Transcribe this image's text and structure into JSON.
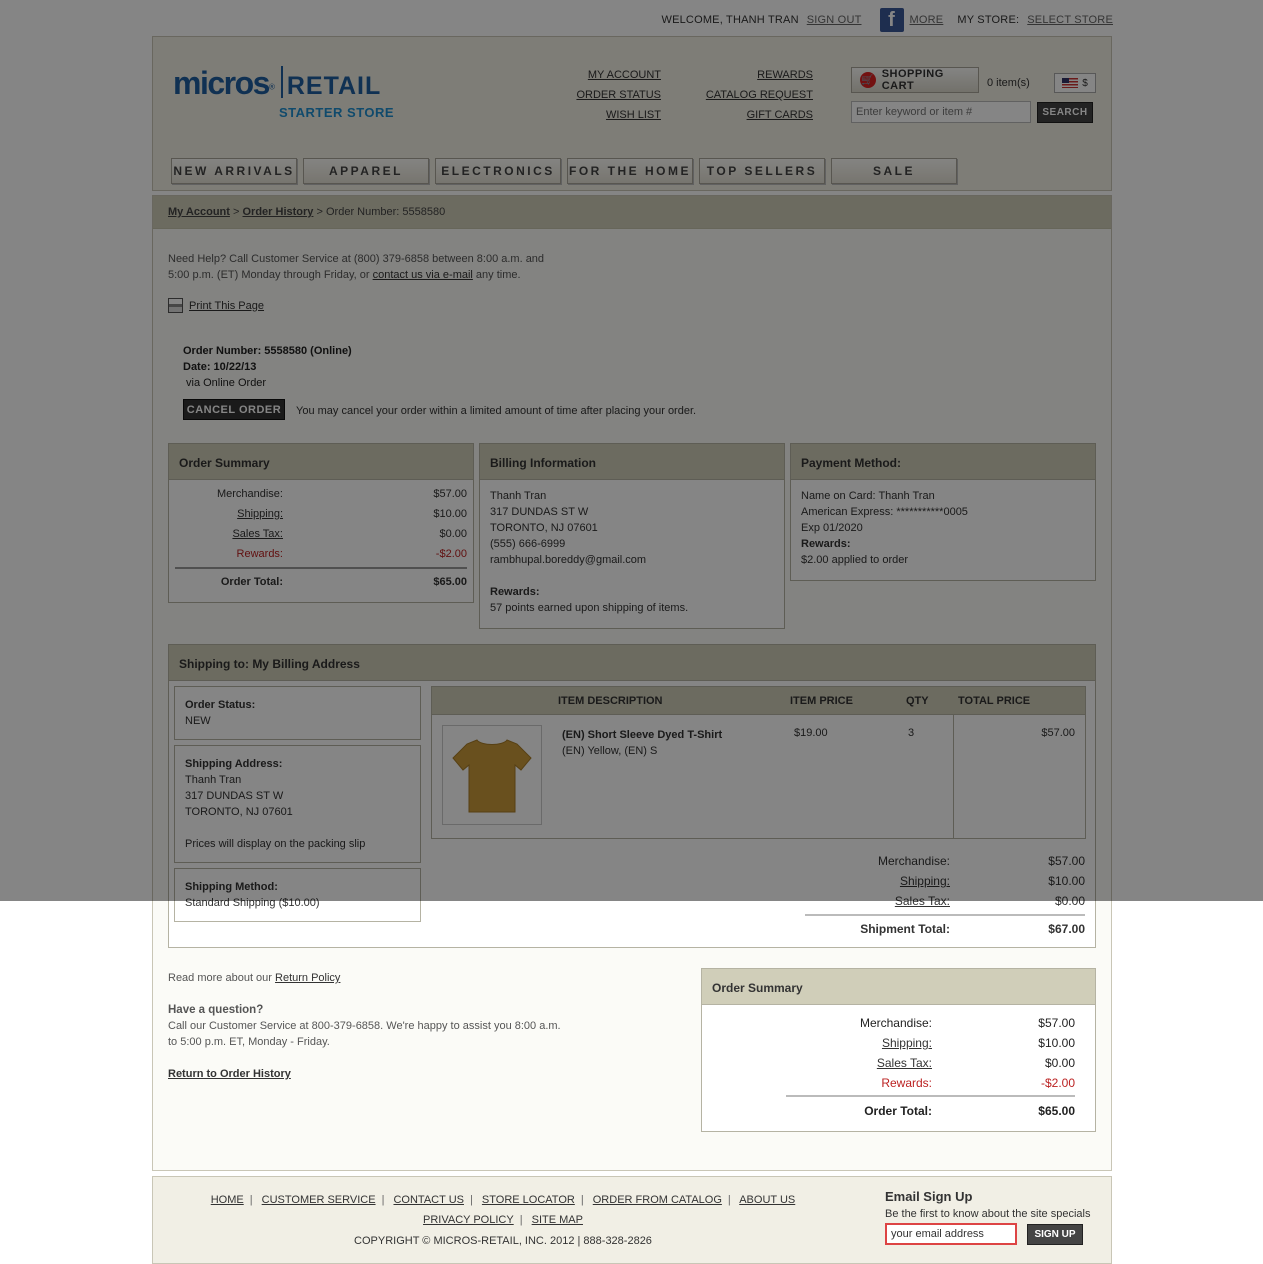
{
  "topbar": {
    "welcome": "WELCOME, THANH TRAN",
    "sign_out": "SIGN OUT",
    "more": "MORE",
    "my_store": "MY STORE:",
    "select_store": "SELECT STORE"
  },
  "logo": {
    "micros": "micros",
    "retail": "RETAIL",
    "starter": "STARTER STORE",
    "reg": "®"
  },
  "header_links_col1": [
    "MY ACCOUNT",
    "ORDER STATUS",
    "WISH LIST"
  ],
  "header_links_col2": [
    "REWARDS",
    "CATALOG REQUEST",
    "GIFT CARDS"
  ],
  "cart": {
    "label": "SHOPPING CART",
    "count": "0 item(s)",
    "currency": "$"
  },
  "search": {
    "placeholder": "Enter keyword or item #",
    "button": "SEARCH"
  },
  "nav": [
    "NEW ARRIVALS",
    "APPAREL",
    "ELECTRONICS",
    "FOR THE HOME",
    "TOP SELLERS",
    "SALE"
  ],
  "breadcrumb": {
    "my_account": "My Account",
    "order_history": "Order History",
    "sep": ">",
    "current": "Order Number: 5558580"
  },
  "help": {
    "line1": "Need Help?  Call Customer Service at (800) 379-6858 between 8:00 a.m. and",
    "line2_pre": "5:00 p.m. (ET) Monday through Friday, or ",
    "contact_link": "contact us via e-mail",
    "line2_post": " any time."
  },
  "print": "Print This Page",
  "order": {
    "number": "Order Number: 5558580 (Online)",
    "date": "Date: 10/22/13",
    "via": "via Online Order",
    "cancel_button": "CANCEL ORDER",
    "cancel_msg": "You may cancel your order within a limited amount of time after placing your order."
  },
  "order_summary": {
    "title": "Order Summary",
    "merchandise_label": "Merchandise:",
    "merchandise": "$57.00",
    "shipping_label": "Shipping:",
    "shipping": "$10.00",
    "tax_label": "Sales Tax:",
    "tax": "$0.00",
    "rewards_label": "Rewards:",
    "rewards": "-$2.00",
    "total_label": "Order Total:",
    "total": "$65.00"
  },
  "billing": {
    "title": "Billing Information",
    "name": "Thanh Tran",
    "street": "317 DUNDAS ST W",
    "city": "TORONTO, NJ 07601",
    "phone": "(555) 666-6999",
    "email": "rambhupal.boreddy@gmail.com",
    "rewards_label": "Rewards:",
    "rewards": "57 points earned upon shipping of items."
  },
  "payment": {
    "title": "Payment Method:",
    "name": "Name on Card: Thanh Tran",
    "card": "American Express: ***********0005",
    "exp": "Exp 01/2020",
    "rewards_label": "Rewards:",
    "rewards": "$2.00 applied to order"
  },
  "shipping": {
    "title": "Shipping to:  My Billing Address",
    "status_label": "Order Status:",
    "status": "NEW",
    "address_label": "Shipping Address:",
    "name": "Thanh Tran",
    "street": "317 DUNDAS ST W",
    "city": "TORONTO, NJ 07601",
    "note": "Prices will display on the packing slip",
    "method_label": "Shipping Method:",
    "method": "Standard Shipping ($10.00)"
  },
  "items_table": {
    "headers": [
      "ITEM DESCRIPTION",
      "ITEM PRICE",
      "QTY",
      "TOTAL PRICE"
    ],
    "rows": [
      {
        "name": "(EN) Short Sleeve Dyed T-Shirt",
        "variant": "(EN) Yellow, (EN) S",
        "price": "$19.00",
        "qty": "3",
        "total": "$57.00"
      }
    ]
  },
  "shipment_summary": {
    "merchandise_label": "Merchandise:",
    "merchandise": "$57.00",
    "shipping_label": "Shipping:",
    "shipping": "$10.00",
    "tax_label": "Sales Tax:",
    "tax": "$0.00",
    "total_label": "Shipment Total:",
    "total": "$67.00"
  },
  "bottom": {
    "return_pre": "Read more about our ",
    "return_link": "Return Policy",
    "question": "Have a question?",
    "q1": "Call our Customer Service at 800-379-6858. We're happy to assist you 8:00 a.m.",
    "q2": "to 5:00 p.m. ET, Monday - Friday.",
    "return_history": "Return to Order History"
  },
  "footer": {
    "links": [
      "HOME",
      "CUSTOMER SERVICE",
      "CONTACT US",
      "STORE LOCATOR",
      "ORDER FROM CATALOG",
      "ABOUT US"
    ],
    "links2": [
      "PRIVACY POLICY",
      "SITE MAP"
    ],
    "copyright": "COPYRIGHT © MICROS-RETAIL, INC. 2012 | 888-328-2826",
    "signup_title": "Email Sign Up",
    "signup_sub": "Be the first to know about the site specials",
    "email_value": "your email address",
    "signup_button": "SIGN UP"
  }
}
